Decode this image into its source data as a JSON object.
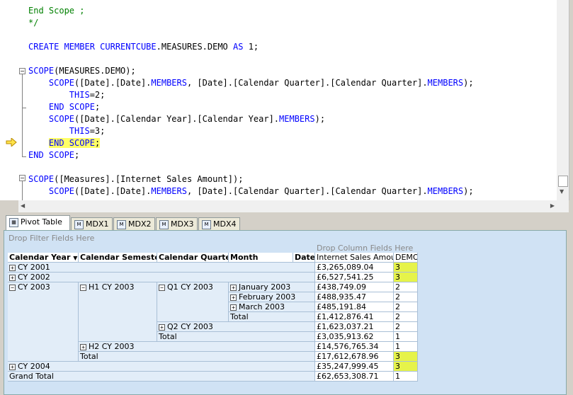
{
  "editor": {
    "lines": {
      "l1": "End Scope ;",
      "l2": "*/",
      "l3a": "CREATE MEMBER",
      "l3b": "CURRENTCUBE",
      "l3c": ".MEASURES.DEMO",
      "l3d": "AS",
      "l3e": " 1;",
      "l4a": "SCOPE",
      "l4b": "(MEASURES.DEMO);",
      "l5a": "SCOPE",
      "l5b": "([Date].[Date].",
      "l5c": "MEMBERS",
      "l5d": ", [Date].[Calendar Quarter].[Calendar Quarter].",
      "l5e": "MEMBERS",
      "l5f": ");",
      "l6a": "THIS",
      "l6b": "=2;",
      "l7a": "END SCOPE",
      "l7b": ";",
      "l8a": "SCOPE",
      "l8b": "([Date].[Calendar Year].[Calendar Year].",
      "l8c": "MEMBERS",
      "l8d": ");",
      "l9a": "THIS",
      "l9b": "=3;",
      "l10a": "END SCOPE",
      "l10b": ";",
      "l11a": "END SCOPE",
      "l11b": ";",
      "l12a": "SCOPE",
      "l12b": "([Measures].[Internet Sales Amount]);",
      "l13a": "SCOPE",
      "l13b": "([Date].[Date].",
      "l13c": "MEMBERS",
      "l13d": ", [Date].[Calendar Quarter].[Calendar Quarter].",
      "l13e": "MEMBERS",
      "l13f": ");"
    }
  },
  "tabs": {
    "pivot": "Pivot Table",
    "mdx1": "MDX1",
    "mdx2": "MDX2",
    "mdx3": "MDX3",
    "mdx4": "MDX4"
  },
  "pivot": {
    "drop_filter": "Drop Filter Fields Here",
    "drop_column": "Drop Column Fields Here",
    "headers": {
      "year": "Calendar Year",
      "sort_arrow": "▼",
      "semester": "Calendar Semester",
      "quarter": "Calendar Quarter",
      "month": "Month",
      "date": "Date",
      "sales": "Internet Sales Amount",
      "demo": "DEMO"
    },
    "rows": {
      "cy2001": "CY 2001",
      "cy2002": "CY 2002",
      "cy2003": "CY 2003",
      "h1cy2003": "H1 CY 2003",
      "q1cy2003": "Q1 CY 2003",
      "jan2003": "January 2003",
      "feb2003": "February 2003",
      "mar2003": "March 2003",
      "total_q1": "Total",
      "q2cy2003": "Q2 CY 2003",
      "total_h1": "Total",
      "h2cy2003": "H2 CY 2003",
      "total_cy2003": "Total",
      "cy2004": "CY 2004",
      "grand_total": "Grand Total"
    },
    "values": [
      {
        "sales": "£3,265,089.04",
        "demo": "3"
      },
      {
        "sales": "£6,527,541.25",
        "demo": "3"
      },
      {
        "sales": "£438,749.09",
        "demo": "2"
      },
      {
        "sales": "£488,935.47",
        "demo": "2"
      },
      {
        "sales": "£485,191.84",
        "demo": "2"
      },
      {
        "sales": "£1,412,876.41",
        "demo": "2"
      },
      {
        "sales": "£1,623,037.21",
        "demo": "2"
      },
      {
        "sales": "£3,035,913.62",
        "demo": "1"
      },
      {
        "sales": "£14,576,765.34",
        "demo": "1"
      },
      {
        "sales": "£17,612,678.96",
        "demo": "3"
      },
      {
        "sales": "£35,247,999.45",
        "demo": "3"
      },
      {
        "sales": "£62,653,308.71",
        "demo": "1"
      }
    ]
  },
  "colors": {
    "keyword": "#0000ff",
    "comment": "#008000",
    "highlight": "#ffff66",
    "demo_highlight": "#e6f34a",
    "pivot_background": "#d0e2f4"
  }
}
